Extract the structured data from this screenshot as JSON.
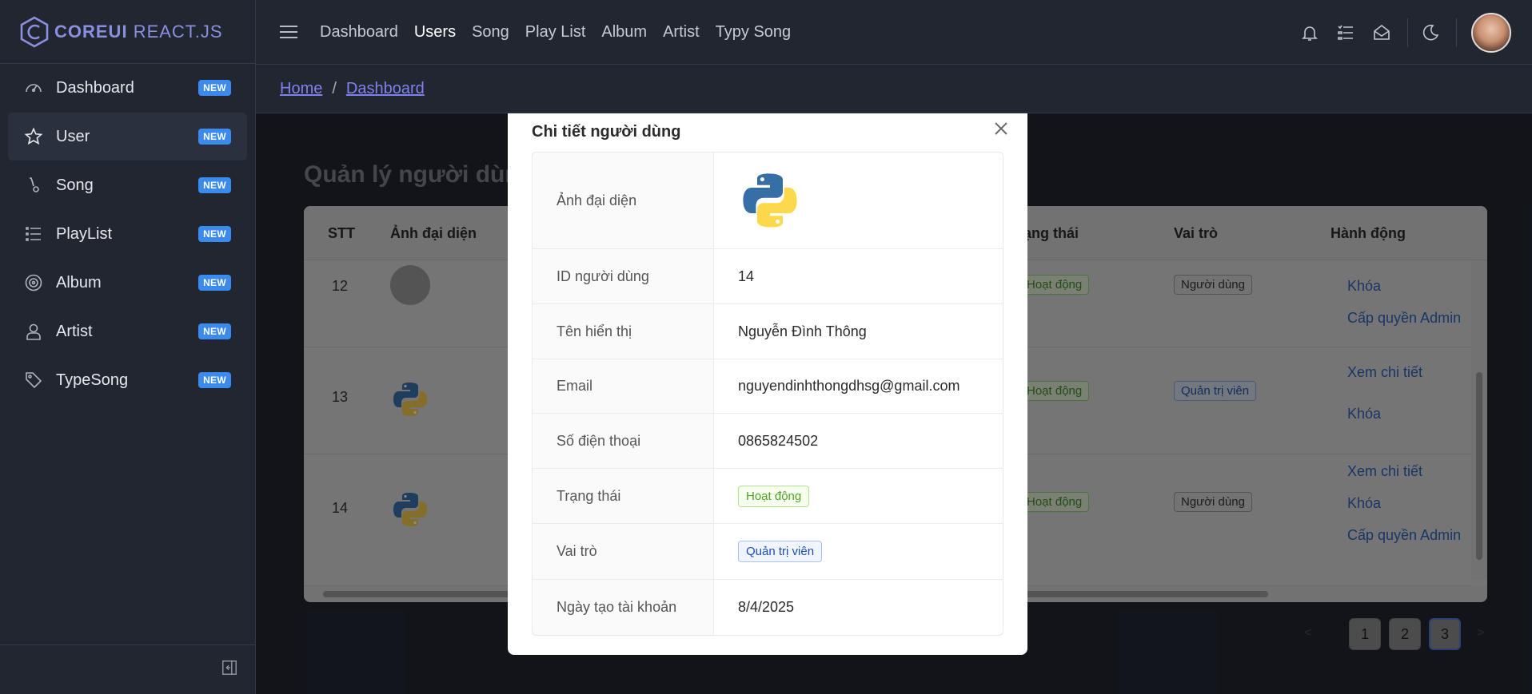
{
  "brand": {
    "core": "COREUI",
    "suffix": "REACT.JS"
  },
  "sidebar": {
    "items": [
      {
        "label": "Dashboard",
        "icon": "speedometer-icon",
        "badge": "NEW",
        "active": false
      },
      {
        "label": "User",
        "icon": "star-icon",
        "badge": "NEW",
        "active": true
      },
      {
        "label": "Song",
        "icon": "music-note-icon",
        "badge": "NEW",
        "active": false
      },
      {
        "label": "PlayList",
        "icon": "list-icon",
        "badge": "NEW",
        "active": false
      },
      {
        "label": "Album",
        "icon": "disc-icon",
        "badge": "NEW",
        "active": false
      },
      {
        "label": "Artist",
        "icon": "user-icon",
        "badge": "NEW",
        "active": false
      },
      {
        "label": "TypeSong",
        "icon": "tag-icon",
        "badge": "NEW",
        "active": false
      }
    ]
  },
  "header": {
    "nav": [
      "Dashboard",
      "Users",
      "Song",
      "Play List",
      "Album",
      "Artist",
      "Typy Song"
    ],
    "active_nav": "Users"
  },
  "breadcrumb": {
    "home": "Home",
    "separator": "/",
    "current": "Dashboard"
  },
  "page": {
    "title": "Quản lý người dùng"
  },
  "table": {
    "headers": [
      "STT",
      "Ảnh đại diện",
      "rạng thái",
      "Vai trò",
      "Hành động"
    ],
    "rows": [
      {
        "stt": "12",
        "avatar": "gray",
        "status": "Hoạt động",
        "role": "Người dùng",
        "role_type": "gray",
        "actions": [
          "Khóa",
          "Cấp quyền Admin"
        ]
      },
      {
        "stt": "13",
        "avatar": "python",
        "status": "Hoạt động",
        "role": "Quản trị viên",
        "role_type": "blue",
        "actions": [
          "Xem chi tiết",
          "Khóa"
        ]
      },
      {
        "stt": "14",
        "avatar": "python",
        "status": "Hoạt động",
        "role": "Người dùng",
        "role_type": "gray",
        "actions": [
          "Xem chi tiết",
          "Khóa",
          "Cấp quyền Admin"
        ]
      }
    ]
  },
  "pagination": {
    "pages": [
      "1",
      "2",
      "3"
    ],
    "current": "3",
    "prev": "<",
    "next": ">"
  },
  "modal": {
    "title": "Chi tiết người dùng",
    "fields": [
      {
        "label": "Ảnh đại diện",
        "value": ""
      },
      {
        "label": "ID người dùng",
        "value": "14"
      },
      {
        "label": "Tên hiển thị",
        "value": "Nguyễn Đình Thông"
      },
      {
        "label": "Email",
        "value": "nguyendinhthongdhsg@gmail.com"
      },
      {
        "label": "Số điện thoại",
        "value": "0865824502"
      },
      {
        "label": "Trạng thái",
        "value": "Hoạt động"
      },
      {
        "label": "Vai trò",
        "value": "Quản trị viên"
      },
      {
        "label": "Ngày tạo tài khoản",
        "value": "8/4/2025"
      }
    ]
  },
  "colors": {
    "accent": "#3b8bef",
    "brand": "#8b8fe0",
    "link": "#7e82f0",
    "success": "#52a12a",
    "info": "#1e4fb4"
  }
}
